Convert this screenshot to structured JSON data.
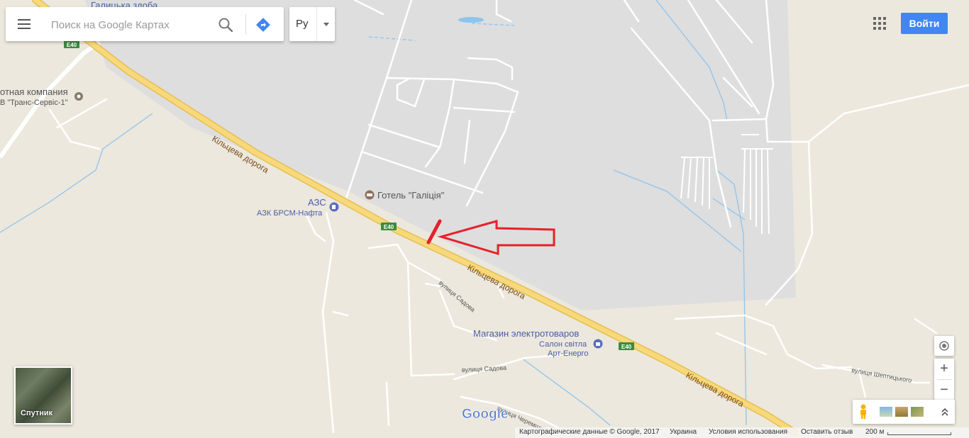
{
  "search": {
    "placeholder": "Поиск на Google Картах"
  },
  "language": {
    "label": "Ру"
  },
  "header": {
    "signin_label": "Войти"
  },
  "satellite": {
    "label": "Спутник"
  },
  "zoom": {
    "plus": "+",
    "minus": "−"
  },
  "map_labels": {
    "poi_top": "Галицька здоба",
    "company_line1": "отная компания",
    "company_line2": "В \"Транс-Сервіс-1\"",
    "ring_road_1": "Кільцева дорога",
    "ring_road_2": "Кільцева дорога",
    "ring_road_3": "Кільцева дорога",
    "hotel": "Готель \"Галіція\"",
    "gas_station": "АЗС",
    "gas_station_name": "АЗК БРСМ-Нафта",
    "e40_1": "E40",
    "e40_2": "E40",
    "e40_3": "E40",
    "street_sadova_1": "вулиця Садова",
    "street_sadova_2": "вулиця Садова",
    "shop": "Магазин электротоваров",
    "salon_line1": "Салон світла",
    "salon_line2": "Арт-Енерго",
    "street_sheptytskoho": "вулиця Шептицького",
    "street_cheremshyny": "вулиця Черемшини",
    "google_logo": "Google"
  },
  "footer": {
    "copyright": "Картографические данные © Google, 2017",
    "country": "Украина",
    "terms": "Условия использования",
    "feedback": "Оставить отзыв",
    "scale": "200 м"
  },
  "colors": {
    "land": "#ece8dd",
    "urban": "#dedede",
    "highway": "#f7d97b",
    "highway_border": "#e6be52",
    "road": "#ffffff",
    "water": "#8ec4ee",
    "arrow": "#e8202a",
    "label": "#3a3a3a",
    "poi_label": "#4b5ca8",
    "accent": "#4285f4"
  },
  "icons": [
    "menu-icon",
    "search-icon",
    "directions-icon",
    "apps-grid-icon",
    "hotel-icon",
    "gas-station-icon",
    "shop-icon",
    "my-location-icon",
    "pegman-icon"
  ]
}
